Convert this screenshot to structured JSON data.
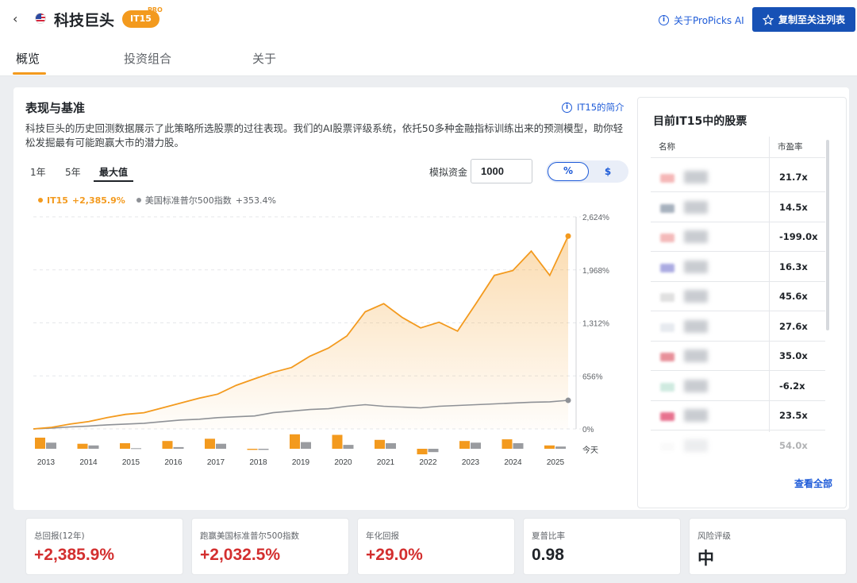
{
  "header": {
    "back": "‹",
    "title": "科技巨头",
    "badge": "IT15",
    "pro": "PRO",
    "about_link": "关于ProPicks AI",
    "copy_button": "复制至关注列表"
  },
  "tabs": [
    "概览",
    "投资组合",
    "关于"
  ],
  "section": {
    "title": "表现与基准",
    "intro_link": "IT15的简介",
    "description": "科技巨头的历史回测数据展示了此策略所选股票的过往表现。我们的AI股票评级系统，依托50多种金融指标训练出来的预测模型，助你轻松发掘最有可能跑赢大市的潜力股。"
  },
  "ranges": [
    "1年",
    "5年",
    "最大值"
  ],
  "capital": {
    "label": "模拟资金",
    "value": "1000"
  },
  "unit_toggle": [
    "%",
    "$"
  ],
  "legend": {
    "series1": "IT15",
    "series1_value": "+2,385.9%",
    "series2": "美国标准普尔500指数",
    "series2_value": "+353.4%"
  },
  "colors": {
    "accent": "#f39a1e",
    "benchmark": "#8e9196",
    "link": "#1e5bd8",
    "positive": "#d32f2f"
  },
  "chart_data": {
    "type": "line",
    "y_ticks": [
      "2,624%",
      "1,968%",
      "1,312%",
      "656%",
      "0%"
    ],
    "ylim": [
      0,
      2624
    ],
    "x_labels": [
      "2013",
      "2014",
      "2015",
      "2016",
      "2017",
      "2018",
      "2019",
      "2020",
      "2021",
      "2022",
      "2023",
      "2024",
      "2025"
    ],
    "end_label": "今天",
    "series": [
      {
        "name": "IT15",
        "values": [
          0,
          20,
          60,
          90,
          140,
          180,
          200,
          260,
          320,
          380,
          430,
          540,
          620,
          700,
          760,
          900,
          1000,
          1150,
          1450,
          1550,
          1380,
          1250,
          1320,
          1210,
          1550,
          1900,
          1960,
          2200,
          1900,
          2385.9
        ]
      },
      {
        "name": "美国标准普尔500指数",
        "values": [
          0,
          10,
          25,
          35,
          50,
          60,
          70,
          90,
          110,
          120,
          140,
          150,
          160,
          200,
          220,
          240,
          250,
          280,
          300,
          280,
          270,
          260,
          280,
          290,
          300,
          310,
          320,
          330,
          335,
          353.4
        ]
      }
    ],
    "annual_bars": {
      "IT15": [
        1.0,
        0.45,
        0.5,
        0.7,
        0.9,
        -0.1,
        1.3,
        1.25,
        0.8,
        -0.5,
        0.7,
        0.85,
        0.3
      ],
      "benchmark": [
        0.55,
        0.3,
        0.05,
        0.15,
        0.45,
        -0.1,
        0.6,
        0.35,
        0.5,
        -0.3,
        0.55,
        0.5,
        0.2
      ]
    }
  },
  "holdings": {
    "title": "目前IT15中的股票",
    "col_name": "名称",
    "col_pe": "市盈率",
    "rows": [
      {
        "pe": "21.7x",
        "logo": "#f2a0a0"
      },
      {
        "pe": "14.5x",
        "logo": "#8a97a8"
      },
      {
        "pe": "-199.0x",
        "logo": "#f0a3a3"
      },
      {
        "pe": "16.3x",
        "logo": "#8f8fd8"
      },
      {
        "pe": "45.6x",
        "logo": "#d6d6d6"
      },
      {
        "pe": "27.6x",
        "logo": "#dfe3ea"
      },
      {
        "pe": "35.0x",
        "logo": "#e06b78"
      },
      {
        "pe": "-6.2x",
        "logo": "#bfe3d6"
      },
      {
        "pe": "23.5x",
        "logo": "#e0446a"
      },
      {
        "pe": "54.0x",
        "logo": "#eeeeee"
      }
    ],
    "view_all": "查看全部"
  },
  "stats": [
    {
      "label": "总回报(12年)",
      "value": "+2,385.9%",
      "tone": "positive"
    },
    {
      "label": "跑赢美国标准普尔500指数",
      "value": "+2,032.5%",
      "tone": "positive"
    },
    {
      "label": "年化回报",
      "value": "+29.0%",
      "tone": "positive"
    },
    {
      "label": "夏普比率",
      "value": "0.98",
      "tone": "neutral"
    },
    {
      "label": "风险评级",
      "value": "中",
      "tone": "neutral"
    }
  ]
}
